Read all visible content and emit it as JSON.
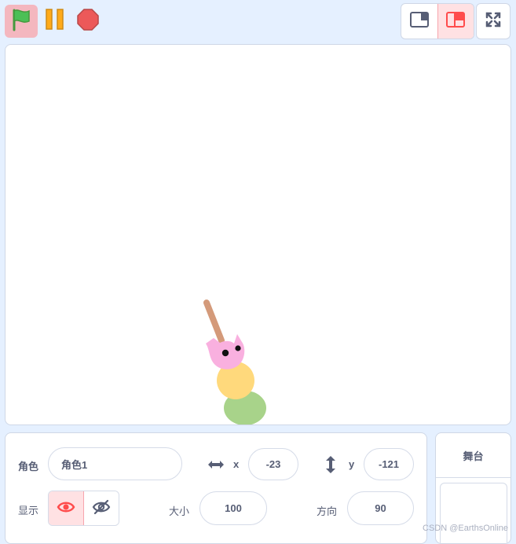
{
  "controls": {
    "green_flag_icon": "green-flag-icon",
    "pause_icon": "pause-icon",
    "stop_icon": "stop-sign-icon",
    "colors": {
      "flag_bg": "#f4b7bf",
      "flag": "#4cbf56",
      "pause": "#f7a800",
      "stop": "#ec5959"
    }
  },
  "layout": {
    "small_stage_icon": "small-stage-icon",
    "large_stage_icon": "large-stage-icon",
    "fullscreen_icon": "fullscreen-icon"
  },
  "sprite_info": {
    "sprite_label": "角色",
    "sprite_name": "角色1",
    "x_label": "x",
    "x_value": "-23",
    "y_label": "y",
    "y_value": "-121",
    "show_label": "显示",
    "size_label": "大小",
    "size_value": "100",
    "direction_label": "方向",
    "direction_value": "90"
  },
  "stage_panel": {
    "title": "舞台"
  },
  "watermark": "CSDN @EarthsOnline",
  "colors": {
    "accent": "#ff4c4c",
    "page_bg": "#e5f0ff",
    "text": "#575e75"
  }
}
